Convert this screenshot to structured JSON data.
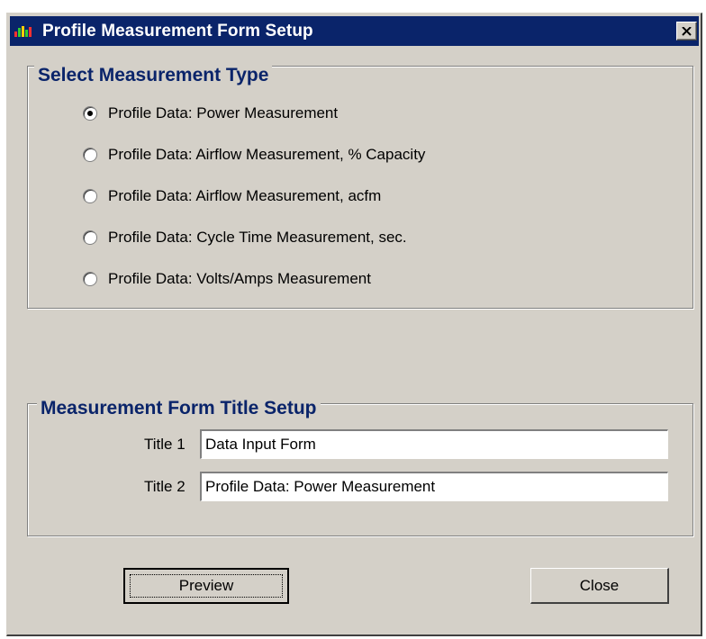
{
  "window": {
    "title": "Profile Measurement Form Setup",
    "close_glyph": "✕"
  },
  "measurement_type": {
    "group_title": "Select Measurement Type",
    "options": [
      {
        "label": "Profile Data: Power Measurement",
        "checked": true
      },
      {
        "label": "Profile Data: Airflow Measurement, % Capacity",
        "checked": false
      },
      {
        "label": "Profile Data: Airflow Measurement, acfm",
        "checked": false
      },
      {
        "label": "Profile Data: Cycle Time Measurement, sec.",
        "checked": false
      },
      {
        "label": "Profile Data: Volts/Amps Measurement",
        "checked": false
      }
    ]
  },
  "title_setup": {
    "group_title": "Measurement Form Title Setup",
    "title1_label": "Title 1",
    "title1_value": "Data Input Form",
    "title2_label": "Title 2",
    "title2_value": "Profile Data: Power Measurement"
  },
  "buttons": {
    "preview_label_first": "P",
    "preview_label_rest": "review",
    "close_label_first": "C",
    "close_label_rest": "lose"
  },
  "colors": {
    "titlebar": "#0a246a",
    "face": "#d4d0c8",
    "group_title": "#0a246a"
  }
}
